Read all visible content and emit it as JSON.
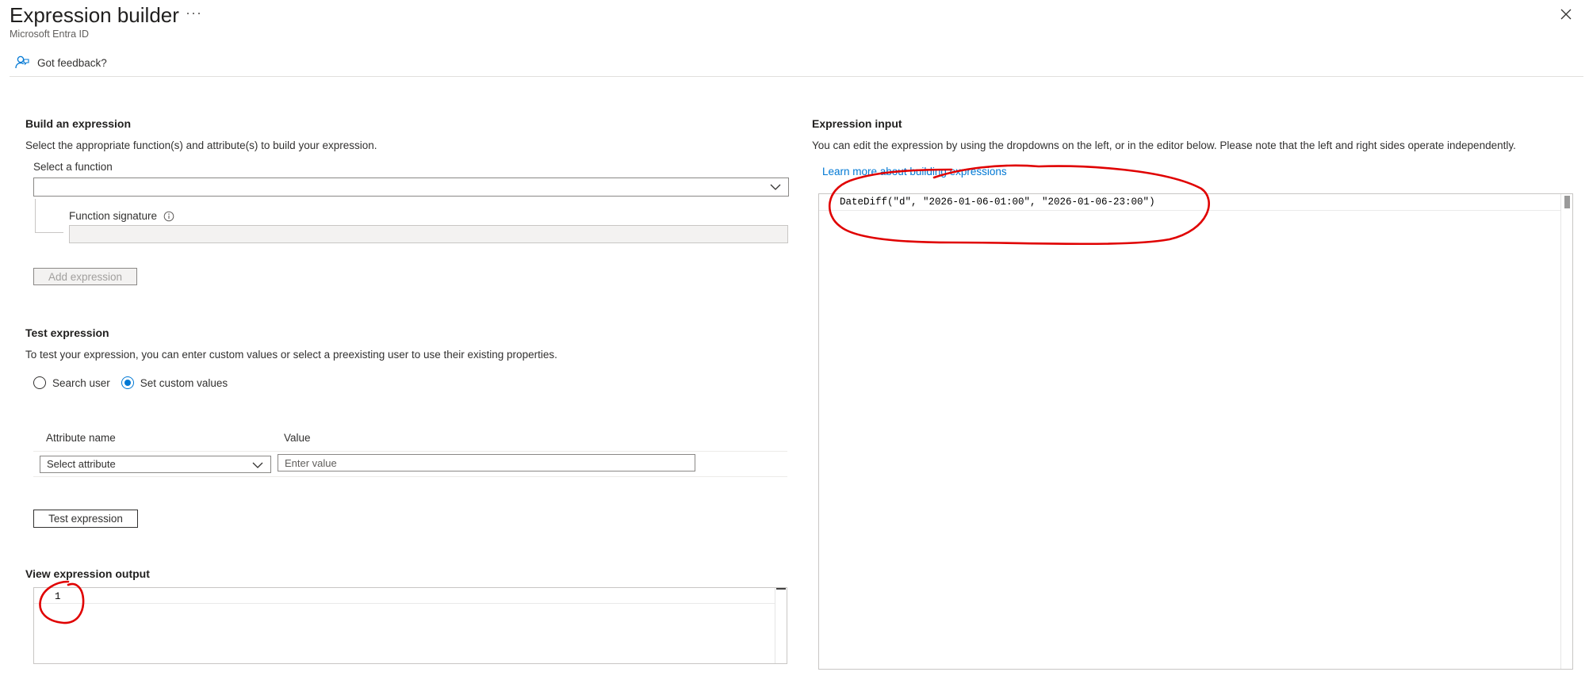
{
  "header": {
    "title": "Expression builder",
    "more_label": "···",
    "subtitle": "Microsoft Entra ID",
    "feedback_label": "Got feedback?"
  },
  "build": {
    "title": "Build an expression",
    "description": "Select the appropriate function(s) and attribute(s) to build your expression.",
    "select_function_label": "Select a function",
    "select_function_value": "",
    "function_signature_label": "Function signature",
    "function_signature_value": "",
    "add_expression_label": "Add expression"
  },
  "test": {
    "title": "Test expression",
    "description": "To test your expression, you can enter custom values or select a preexisting user to use their existing properties.",
    "radio_search_user": "Search user",
    "radio_custom_values": "Set custom values",
    "selected_radio": "Set custom values",
    "columns": [
      "Attribute name",
      "Value"
    ],
    "attribute_placeholder": "Select attribute",
    "value_placeholder": "Enter value",
    "test_button_label": "Test expression"
  },
  "output": {
    "title": "View expression output",
    "value": "1"
  },
  "input": {
    "title": "Expression input",
    "description": "You can edit the expression by using the dropdowns on the left, or in the editor below. Please note that the left and right sides operate independently.",
    "learn_more_label": "Learn more about building expressions",
    "expression": "DateDiff(\"d\", \"2026-01-06-01:00\", \"2026-01-06-23:00\")"
  },
  "colors": {
    "accent": "#0078d4",
    "annotation": "#e00000"
  }
}
